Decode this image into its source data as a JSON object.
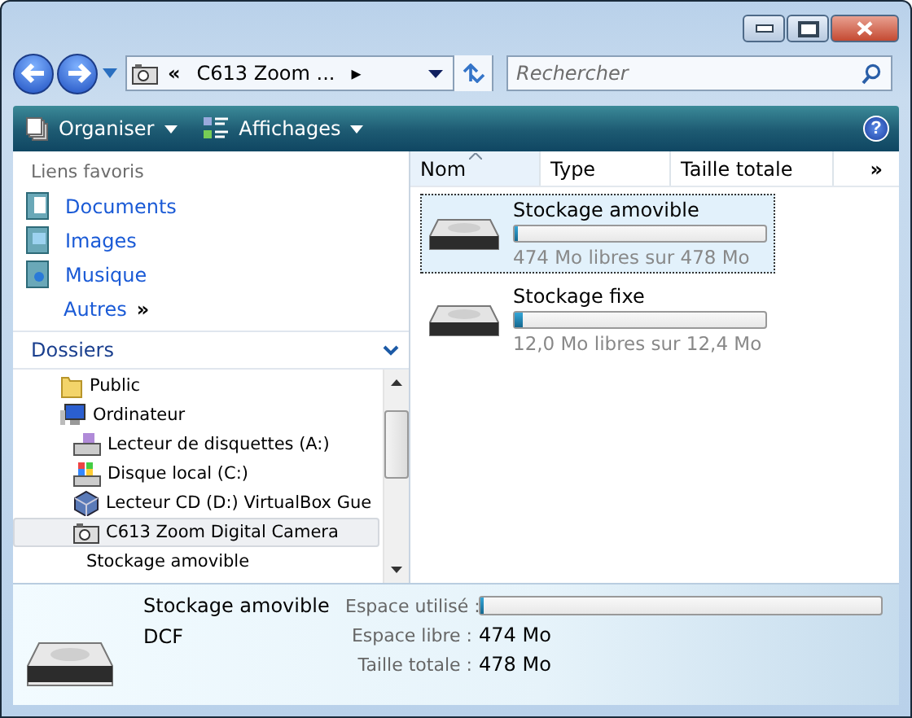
{
  "address": {
    "chevron": "«",
    "location": "C613 Zoom ...",
    "arrow": "▸"
  },
  "search": {
    "placeholder": "Rechercher"
  },
  "help": "?",
  "toolbar": [
    {
      "label": "Organiser",
      "kind": "organize"
    },
    {
      "label": "Affichages",
      "kind": "views"
    }
  ],
  "favorites": {
    "title": "Liens favoris",
    "items": [
      {
        "label": "Documents",
        "kind": "documents"
      },
      {
        "label": "Images",
        "kind": "images"
      },
      {
        "label": "Musique",
        "kind": "music"
      }
    ],
    "more": {
      "label": "Autres",
      "arrow": "»"
    }
  },
  "folders": {
    "title": "Dossiers",
    "tree": [
      {
        "label": "Public",
        "kind": "folder",
        "selected": false
      },
      {
        "label": "Ordinateur",
        "kind": "computer",
        "selected": false,
        "children": [
          {
            "label": "Lecteur de disquettes (A:)",
            "kind": "floppy",
            "selected": false
          },
          {
            "label": "Disque local (C:)",
            "kind": "disk",
            "selected": false
          },
          {
            "label": "Lecteur CD (D:) VirtualBox Gue",
            "kind": "cd",
            "selected": false
          },
          {
            "label": "C613 Zoom Digital Camera",
            "kind": "camera",
            "selected": true,
            "children": [
              {
                "label": "Stockage amovible",
                "selected": false
              }
            ]
          }
        ]
      }
    ]
  },
  "columns": [
    {
      "label": "Nom",
      "sorted": true
    },
    {
      "label": "Type",
      "sorted": false
    },
    {
      "label": "Taille totale",
      "sorted": false
    }
  ],
  "columns_more": "»",
  "items": [
    {
      "name": "Stockage amovible",
      "level": 0.01,
      "free": "474 Mo libres sur 478 Mo",
      "selected": true
    },
    {
      "name": "Stockage fixe",
      "level": 0.03,
      "free": "12,0 Mo libres sur 12,4 Mo",
      "selected": false
    }
  ],
  "details": {
    "name": "Stockage amovible",
    "type": "DCF",
    "fields": [
      {
        "label": "Espace utilisé :",
        "kind": "bar",
        "level": 0.01
      },
      {
        "label": "Espace libre :",
        "kind": "text",
        "value": "474 Mo"
      },
      {
        "label": "Taille totale :",
        "kind": "text",
        "value": "478 Mo"
      }
    ]
  }
}
